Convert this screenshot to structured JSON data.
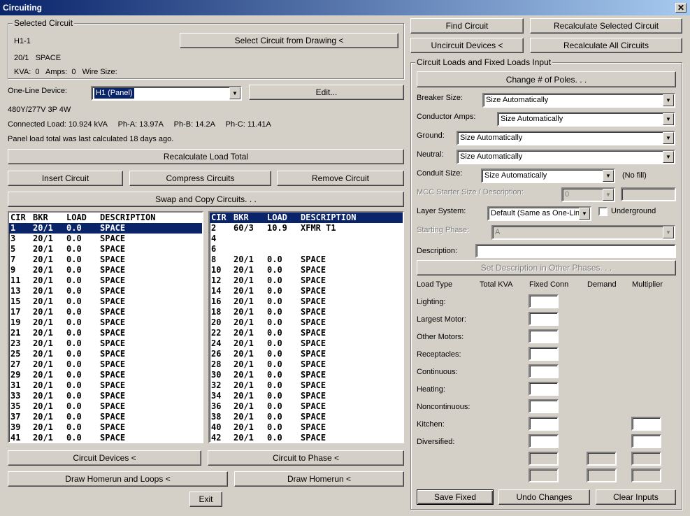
{
  "window": {
    "title": "Circuiting",
    "close": "✕"
  },
  "selected_circuit": {
    "group_title": "Selected Circuit",
    "name": "H1-1",
    "rating": "20/1   SPACE",
    "details": "KVA:  0   Amps:  0   Wire Size:",
    "select_button": "Select Circuit from Drawing <"
  },
  "one_line": {
    "label": "One-Line Device:",
    "value": "H1 (Panel)",
    "edit_button": "Edit...",
    "voltage": "480Y/277V 3P 4W",
    "connected_load": "Connected Load: 10.924 kVA     Ph-A: 13.97A     Ph-B: 14.2A     Ph-C: 11.41A",
    "calc_note": "Panel load total was last calculated 18 days ago."
  },
  "buttons": {
    "recalc_total": "Recalculate Load Total",
    "insert": "Insert Circuit",
    "compress": "Compress Circuits",
    "remove": "Remove Circuit",
    "swap": "Swap and Copy Circuits. . .",
    "circuit_devices": "Circuit Devices <",
    "circuit_phase": "Circuit to Phase <",
    "draw_homerun_loops": "Draw Homerun and Loops <",
    "draw_homerun": "Draw Homerun <",
    "exit": "Exit",
    "find": "Find Circuit",
    "recalc_selected": "Recalculate Selected Circuit",
    "uncircuit": "Uncircuit Devices <",
    "recalc_all": "Recalculate All Circuits"
  },
  "list_header": {
    "cir": "CIR",
    "bkr": "BKR",
    "load": "LOAD",
    "desc": "DESCRIPTION"
  },
  "left_rows": [
    {
      "cir": "1",
      "bkr": "20/1",
      "load": "0.0",
      "desc": "SPACE"
    },
    {
      "cir": "3",
      "bkr": "20/1",
      "load": "0.0",
      "desc": "SPACE"
    },
    {
      "cir": "5",
      "bkr": "20/1",
      "load": "0.0",
      "desc": "SPACE"
    },
    {
      "cir": "7",
      "bkr": "20/1",
      "load": "0.0",
      "desc": "SPACE"
    },
    {
      "cir": "9",
      "bkr": "20/1",
      "load": "0.0",
      "desc": "SPACE"
    },
    {
      "cir": "11",
      "bkr": "20/1",
      "load": "0.0",
      "desc": "SPACE"
    },
    {
      "cir": "13",
      "bkr": "20/1",
      "load": "0.0",
      "desc": "SPACE"
    },
    {
      "cir": "15",
      "bkr": "20/1",
      "load": "0.0",
      "desc": "SPACE"
    },
    {
      "cir": "17",
      "bkr": "20/1",
      "load": "0.0",
      "desc": "SPACE"
    },
    {
      "cir": "19",
      "bkr": "20/1",
      "load": "0.0",
      "desc": "SPACE"
    },
    {
      "cir": "21",
      "bkr": "20/1",
      "load": "0.0",
      "desc": "SPACE"
    },
    {
      "cir": "23",
      "bkr": "20/1",
      "load": "0.0",
      "desc": "SPACE"
    },
    {
      "cir": "25",
      "bkr": "20/1",
      "load": "0.0",
      "desc": "SPACE"
    },
    {
      "cir": "27",
      "bkr": "20/1",
      "load": "0.0",
      "desc": "SPACE"
    },
    {
      "cir": "29",
      "bkr": "20/1",
      "load": "0.0",
      "desc": "SPACE"
    },
    {
      "cir": "31",
      "bkr": "20/1",
      "load": "0.0",
      "desc": "SPACE"
    },
    {
      "cir": "33",
      "bkr": "20/1",
      "load": "0.0",
      "desc": "SPACE"
    },
    {
      "cir": "35",
      "bkr": "20/1",
      "load": "0.0",
      "desc": "SPACE"
    },
    {
      "cir": "37",
      "bkr": "20/1",
      "load": "0.0",
      "desc": "SPACE"
    },
    {
      "cir": "39",
      "bkr": "20/1",
      "load": "0.0",
      "desc": "SPACE"
    },
    {
      "cir": "41",
      "bkr": "20/1",
      "load": "0.0",
      "desc": "SPACE"
    }
  ],
  "right_rows": [
    {
      "cir": "2",
      "bkr": "60/3",
      "load": "10.9",
      "desc": "XFMR T1"
    },
    {
      "cir": "4",
      "bkr": "",
      "load": "",
      "desc": ""
    },
    {
      "cir": "6",
      "bkr": "",
      "load": "",
      "desc": ""
    },
    {
      "cir": "8",
      "bkr": "20/1",
      "load": "0.0",
      "desc": "SPACE"
    },
    {
      "cir": "10",
      "bkr": "20/1",
      "load": "0.0",
      "desc": "SPACE"
    },
    {
      "cir": "12",
      "bkr": "20/1",
      "load": "0.0",
      "desc": "SPACE"
    },
    {
      "cir": "14",
      "bkr": "20/1",
      "load": "0.0",
      "desc": "SPACE"
    },
    {
      "cir": "16",
      "bkr": "20/1",
      "load": "0.0",
      "desc": "SPACE"
    },
    {
      "cir": "18",
      "bkr": "20/1",
      "load": "0.0",
      "desc": "SPACE"
    },
    {
      "cir": "20",
      "bkr": "20/1",
      "load": "0.0",
      "desc": "SPACE"
    },
    {
      "cir": "22",
      "bkr": "20/1",
      "load": "0.0",
      "desc": "SPACE"
    },
    {
      "cir": "24",
      "bkr": "20/1",
      "load": "0.0",
      "desc": "SPACE"
    },
    {
      "cir": "26",
      "bkr": "20/1",
      "load": "0.0",
      "desc": "SPACE"
    },
    {
      "cir": "28",
      "bkr": "20/1",
      "load": "0.0",
      "desc": "SPACE"
    },
    {
      "cir": "30",
      "bkr": "20/1",
      "load": "0.0",
      "desc": "SPACE"
    },
    {
      "cir": "32",
      "bkr": "20/1",
      "load": "0.0",
      "desc": "SPACE"
    },
    {
      "cir": "34",
      "bkr": "20/1",
      "load": "0.0",
      "desc": "SPACE"
    },
    {
      "cir": "36",
      "bkr": "20/1",
      "load": "0.0",
      "desc": "SPACE"
    },
    {
      "cir": "38",
      "bkr": "20/1",
      "load": "0.0",
      "desc": "SPACE"
    },
    {
      "cir": "40",
      "bkr": "20/1",
      "load": "0.0",
      "desc": "SPACE"
    },
    {
      "cir": "42",
      "bkr": "20/1",
      "load": "0.0",
      "desc": "SPACE"
    }
  ],
  "loads_input": {
    "group_title": "Circuit Loads and Fixed Loads Input",
    "change_poles": "Change # of Poles. . .",
    "breaker_label": "Breaker Size:",
    "breaker_value": "Size Automatically",
    "conductor_label": "Conductor Amps:",
    "conductor_value": "Size Automatically",
    "ground_label": "Ground:",
    "ground_value": "Size Automatically",
    "neutral_label": "Neutral:",
    "neutral_value": "Size Automatically",
    "conduit_label": "Conduit Size:",
    "conduit_value": "Size Automatically",
    "no_fill": "(No fill)",
    "mcc_label": "MCC Starter Size / Description:",
    "mcc_value": "0",
    "layer_label": "Layer System:",
    "layer_value": "Default (Same as One-Line",
    "underground_label": "Underground",
    "phase_label": "Starting Phase:",
    "phase_value": "A",
    "description_label": "Description:",
    "set_desc_button": "Set Description in Other Phases. . .",
    "col_load_type": "Load Type",
    "col_total_kva": "Total KVA",
    "col_fixed": "Fixed Conn",
    "col_demand": "Demand",
    "col_multiplier": "Multiplier",
    "load_types": [
      "Lighting:",
      "Largest Motor:",
      "Other Motors:",
      "Receptacles:",
      "Continuous:",
      "Heating:",
      "Noncontinuous:",
      "Kitchen:",
      "Diversified:"
    ],
    "save_fixed": "Save Fixed",
    "undo": "Undo Changes",
    "clear": "Clear Inputs"
  }
}
